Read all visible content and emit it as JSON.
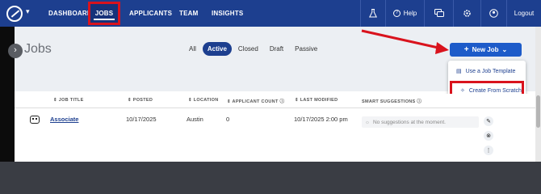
{
  "nav": {
    "items": [
      {
        "label": "DASHBOARD"
      },
      {
        "label": "JOBS"
      },
      {
        "label": "APPLICANTS"
      },
      {
        "label": "TEAM"
      },
      {
        "label": "INSIGHTS"
      }
    ],
    "help_label": "Help",
    "logout_label": "Logout"
  },
  "header": {
    "title": "Jobs",
    "filters": [
      "All",
      "Active",
      "Closed",
      "Draft",
      "Passive"
    ],
    "active_filter": "Active",
    "new_job_label": "New Job",
    "dropdown": {
      "items": [
        {
          "label": "Use a Job Template"
        },
        {
          "label": "Create From Scratch"
        }
      ]
    }
  },
  "table": {
    "columns": [
      "JOB TITLE",
      "POSTED",
      "LOCATION",
      "APPLICANT COUNT",
      "LAST MODIFIED",
      "SMART SUGGESTIONS"
    ],
    "rows": [
      {
        "job_title": "Associate",
        "posted": "10/17/2025",
        "location": "Austin",
        "applicant_count": "0",
        "last_modified": "10/17/2025 2:00 pm",
        "suggestion": "No suggestions at the moment."
      }
    ]
  },
  "colors": {
    "nav": "#1d3f8f",
    "accent": "#1d5bc9",
    "highlight": "#d9131d"
  },
  "icons": [
    "logo-icon",
    "flask-icon",
    "help-icon",
    "chat-icon",
    "gear-icon",
    "user-icon",
    "robot-icon",
    "pencil-icon",
    "close-circle-icon",
    "more-icon",
    "plus-icon",
    "chevron-down-icon",
    "chevron-right-icon"
  ]
}
